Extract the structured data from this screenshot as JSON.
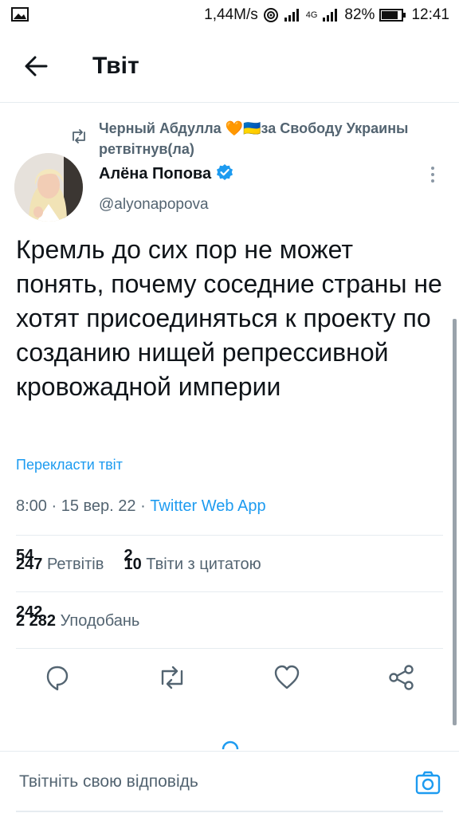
{
  "status_bar": {
    "speed": "1,44M/s",
    "network": "4G",
    "battery": "82%",
    "time": "12:41"
  },
  "header": {
    "title": "Твіт"
  },
  "retweet": {
    "text": "Черный Абдулла 🧡🇺🇦за Свободу Украины ретвітнув(ла)"
  },
  "author": {
    "name": "Алёна Попова",
    "handle": "@alyonapopova",
    "verified": true
  },
  "tweet": {
    "text": "Кремль до сих пор не может понять, почему соседние страны не хотят присоединяться к проекту по созданию нищей репрессивной кровожадной империи",
    "translate_label": "Перекласти твіт",
    "time": "8:00",
    "date": "15 вер. 22",
    "app": "Twitter Web App"
  },
  "stats": {
    "retweets_old": "54",
    "retweets": "247",
    "retweets_label": "Ретвітів",
    "quotes_old": "2",
    "quotes": "10",
    "quotes_label": "Твіти з цитатою",
    "likes_old": "242",
    "likes": "2 282",
    "likes_label": "Уподобань"
  },
  "reply": {
    "placeholder": "Твітніть свою відповідь"
  },
  "colors": {
    "accent": "#1d9bf0",
    "muted": "#536471",
    "heart": "#f5a05a"
  },
  "icons": [
    "image-icon",
    "wifi-icon",
    "signal-icon",
    "battery-icon",
    "back-arrow-icon",
    "retweet-icon",
    "verified-badge-icon",
    "more-vertical-icon",
    "reply-icon",
    "retweet-action-icon",
    "like-icon",
    "share-icon",
    "camera-icon"
  ]
}
